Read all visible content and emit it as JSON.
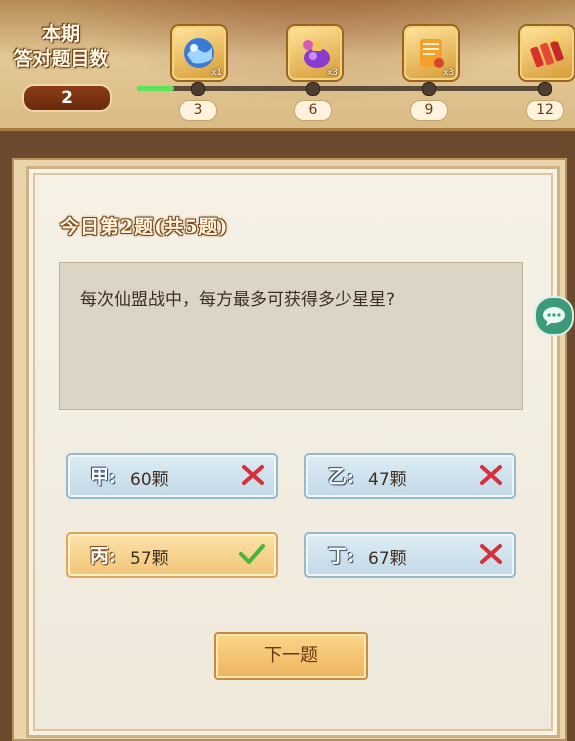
{
  "header": {
    "round_title_line1": "本期",
    "round_title_line2": "答对题目数",
    "correct_count": "2",
    "progress_fraction": 0.09,
    "milestones": [
      {
        "label": "3",
        "reward_icon": "wave-orb-icon",
        "reward_count": "x1"
      },
      {
        "label": "6",
        "reward_icon": "purple-potion-icon",
        "reward_count": "x3"
      },
      {
        "label": "9",
        "reward_icon": "golden-scroll-icon",
        "reward_count": "x3"
      },
      {
        "label": "12",
        "reward_icon": "firecracker-icon",
        "reward_count": ""
      }
    ]
  },
  "question": {
    "header": "今日第2题(共5题)",
    "text": "每次仙盟战中，每方最多可获得多少星星?"
  },
  "options": [
    {
      "letter": "甲:",
      "text": "60颗",
      "status": "wrong",
      "mark_icon": "red-cross-icon"
    },
    {
      "letter": "乙:",
      "text": "47颗",
      "status": "wrong",
      "mark_icon": "red-cross-icon"
    },
    {
      "letter": "丙:",
      "text": "57颗",
      "status": "correct",
      "mark_icon": "green-check-icon"
    },
    {
      "letter": "丁:",
      "text": "67颗",
      "status": "wrong",
      "mark_icon": "red-cross-icon"
    }
  ],
  "next_button": {
    "label": "下一题"
  },
  "colors": {
    "progress": "#5fe35a",
    "wrong": "#d8303a",
    "correct": "#47b53c"
  }
}
